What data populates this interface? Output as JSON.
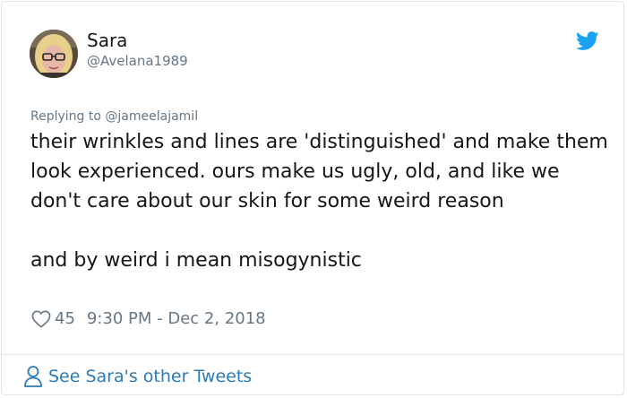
{
  "author": {
    "display_name": "Sara",
    "handle": "@Avelana1989"
  },
  "icons": {
    "brand": "twitter-bird-icon",
    "like": "heart-icon",
    "profile": "person-icon"
  },
  "reply": {
    "prefix": "Replying to ",
    "to": "@jameelajamil"
  },
  "tweet": {
    "paragraphs": [
      "their wrinkles and lines are 'distinguished' and make them look experienced. ours make us ugly, old, and like we don't care about our skin for some weird reason",
      "and by weird i mean misogynistic"
    ]
  },
  "meta": {
    "likes": "45",
    "timestamp": "9:30 PM - Dec 2, 2018"
  },
  "footer": {
    "link_label": "See Sara's other Tweets"
  },
  "colors": {
    "link": "#2b7bb9",
    "twitter_blue": "#1da1f2",
    "muted": "#657786",
    "border": "#e1e8ed"
  }
}
